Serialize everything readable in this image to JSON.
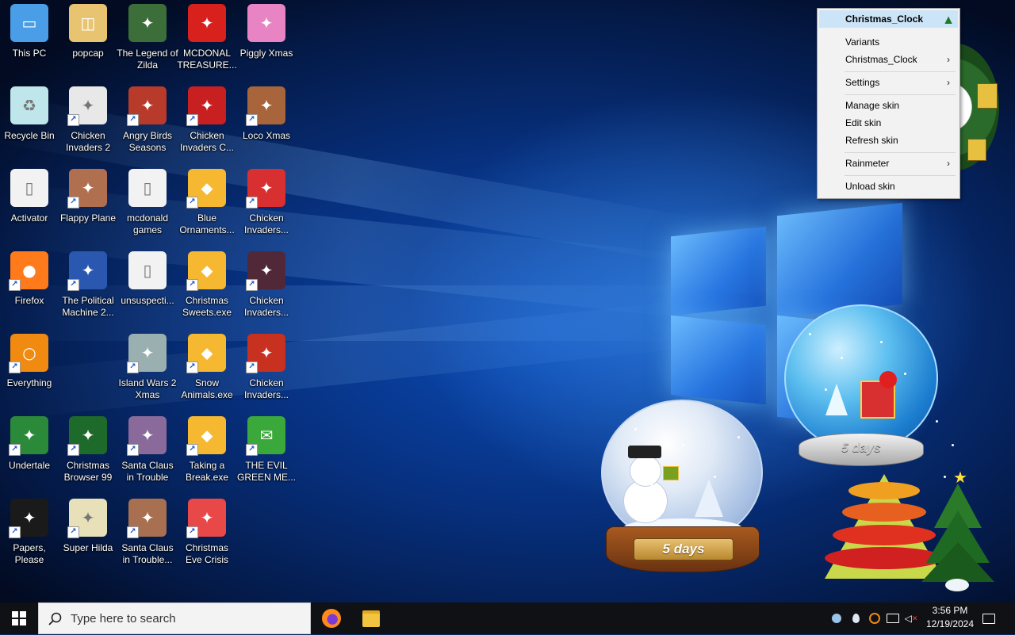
{
  "desktop": {
    "icons": [
      {
        "label": "This PC",
        "icon": "computer-icon",
        "color": "#4a9ee8"
      },
      {
        "label": "popcap",
        "icon": "folder-icon",
        "color": "#e8c470"
      },
      {
        "label": "The Legend of Zilda",
        "icon": "game-icon",
        "color": "#3c6e3a"
      },
      {
        "label": "MCDONAL TREASURE...",
        "icon": "game-icon",
        "color": "#d8201c"
      },
      {
        "label": "Piggly Xmas",
        "icon": "game-icon",
        "color": "#e884c4"
      },
      {
        "label": "Recycle Bin",
        "icon": "recycle-bin-icon",
        "color": "#bfe6ea"
      },
      {
        "label": "Chicken Invaders 2",
        "icon": "game-icon",
        "color": "#e8e8e8"
      },
      {
        "label": "Angry Birds Seasons",
        "icon": "game-icon",
        "color": "#b83a2a"
      },
      {
        "label": "Chicken Invaders C...",
        "icon": "game-icon",
        "color": "#c82020"
      },
      {
        "label": "Loco Xmas",
        "icon": "game-icon",
        "color": "#a8643a"
      },
      {
        "label": "Activator",
        "icon": "file-icon",
        "color": "#f2f2f2"
      },
      {
        "label": "Flappy Plane",
        "icon": "game-icon",
        "color": "#b07050"
      },
      {
        "label": "mcdonald games",
        "icon": "file-icon",
        "color": "#f2f2f2"
      },
      {
        "label": "Blue Ornaments...",
        "icon": "installer-icon",
        "color": "#f5b830"
      },
      {
        "label": "Chicken Invaders...",
        "icon": "game-icon",
        "color": "#d83030"
      },
      {
        "label": "Firefox",
        "icon": "firefox-icon",
        "color": "#ff7a1a"
      },
      {
        "label": "The Political Machine 2...",
        "icon": "game-icon",
        "color": "#2a58b0"
      },
      {
        "label": "unsuspecti...",
        "icon": "file-icon",
        "color": "#f2f2f2"
      },
      {
        "label": "Christmas Sweets.exe",
        "icon": "installer-icon",
        "color": "#f5b830"
      },
      {
        "label": "Chicken Invaders...",
        "icon": "game-icon",
        "color": "#502838"
      },
      {
        "label": "Everything",
        "icon": "search-magnifier-icon",
        "color": "#f08a10"
      },
      {
        "label": "Island Wars 2 Xmas",
        "icon": "game-icon",
        "color": "#9ab0b0"
      },
      {
        "label": "Snow Animals.exe",
        "icon": "installer-icon",
        "color": "#f5b830"
      },
      {
        "label": "Chicken Invaders...",
        "icon": "game-icon",
        "color": "#c83020"
      },
      {
        "label": "Undertale",
        "icon": "game-icon",
        "color": "#2a8a3a"
      },
      {
        "label": "Christmas Browser 99",
        "icon": "game-icon",
        "color": "#1e6a2a"
      },
      {
        "label": "Santa Claus in Trouble",
        "icon": "game-icon",
        "color": "#8a6a9a"
      },
      {
        "label": "Taking a Break.exe",
        "icon": "installer-icon",
        "color": "#f5b830"
      },
      {
        "label": "THE EVIL GREEN ME...",
        "icon": "messenger-icon",
        "color": "#3aa83a"
      },
      {
        "label": "Papers, Please",
        "icon": "game-icon",
        "color": "#1a1a1a"
      },
      {
        "label": "Super Hilda",
        "icon": "game-icon",
        "color": "#e8e0b8"
      },
      {
        "label": "Santa Claus in Trouble...",
        "icon": "game-icon",
        "color": "#a87050"
      },
      {
        "label": "Christmas Eve Crisis",
        "icon": "game-icon",
        "color": "#e84848"
      }
    ]
  },
  "context_menu": {
    "title": "Christmas_Clock",
    "items": [
      {
        "label": "Variants",
        "submenu": false
      },
      {
        "label": "Christmas_Clock",
        "submenu": true
      },
      {
        "label": "Settings",
        "submenu": true
      },
      {
        "label": "Manage skin",
        "submenu": false
      },
      {
        "label": "Edit skin",
        "submenu": false
      },
      {
        "label": "Refresh skin",
        "submenu": false
      },
      {
        "label": "Rainmeter",
        "submenu": true
      },
      {
        "label": "Unload skin",
        "submenu": false
      }
    ],
    "chevron": "›"
  },
  "widgets": {
    "globe_left_label": "5 days",
    "globe_right_label": "5 days"
  },
  "taskbar": {
    "search_placeholder": "Type here to search",
    "apps": [
      {
        "name": "firefox-icon"
      },
      {
        "name": "file-explorer-icon"
      }
    ],
    "tray_icons": [
      "people-icon",
      "dropbox-icon",
      "everything-icon",
      "network-icon",
      "volume-muted-icon"
    ],
    "time": "3:56 PM",
    "date": "12/19/2024",
    "notification_icon": "notification-icon"
  },
  "colors": {
    "menu_highlight": "#cce4f7",
    "taskbar": "#0f1115",
    "desktop_blue": "#0b4cb8"
  }
}
